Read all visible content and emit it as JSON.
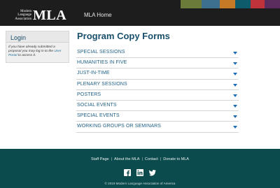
{
  "header": {
    "logo_small_lines": [
      "Modern",
      "Language",
      "Association"
    ],
    "logo_big": "MLA",
    "nav_home": "MLA Home",
    "color_bars": [
      "#6b7b3a",
      "#3d6f8f",
      "#c67a25",
      "#0d5b6b",
      "#c1333b",
      "#5a2d5e"
    ]
  },
  "login": {
    "title": "Login",
    "text_before_link": "If you have already submitted a proposal you may log in to the ",
    "link_text": "User Portal",
    "text_after_link": " to access it."
  },
  "main": {
    "title": "Program Copy Forms",
    "forms": [
      {
        "label": "SPECIAL SESSIONS"
      },
      {
        "label": "HUMANITIES IN FIVE"
      },
      {
        "label": "JUST-IN-TIME"
      },
      {
        "label": "PLENARY SESSIONS"
      },
      {
        "label": "POSTERS"
      },
      {
        "label": "SOCIAL EVENTS"
      },
      {
        "label": "SPECIAL EVENTS"
      },
      {
        "label": "WORKING GROUPS OR SEMINARS"
      }
    ]
  },
  "footer": {
    "links": [
      {
        "label": "Staff Page"
      },
      {
        "label": "About the MLA"
      },
      {
        "label": "Contact"
      },
      {
        "label": "Donate to MLA"
      }
    ],
    "separator": "|",
    "social": [
      "facebook-icon",
      "linkedin-icon",
      "twitter-icon"
    ],
    "copyright": "© 2019 Modern Language Association of America"
  }
}
